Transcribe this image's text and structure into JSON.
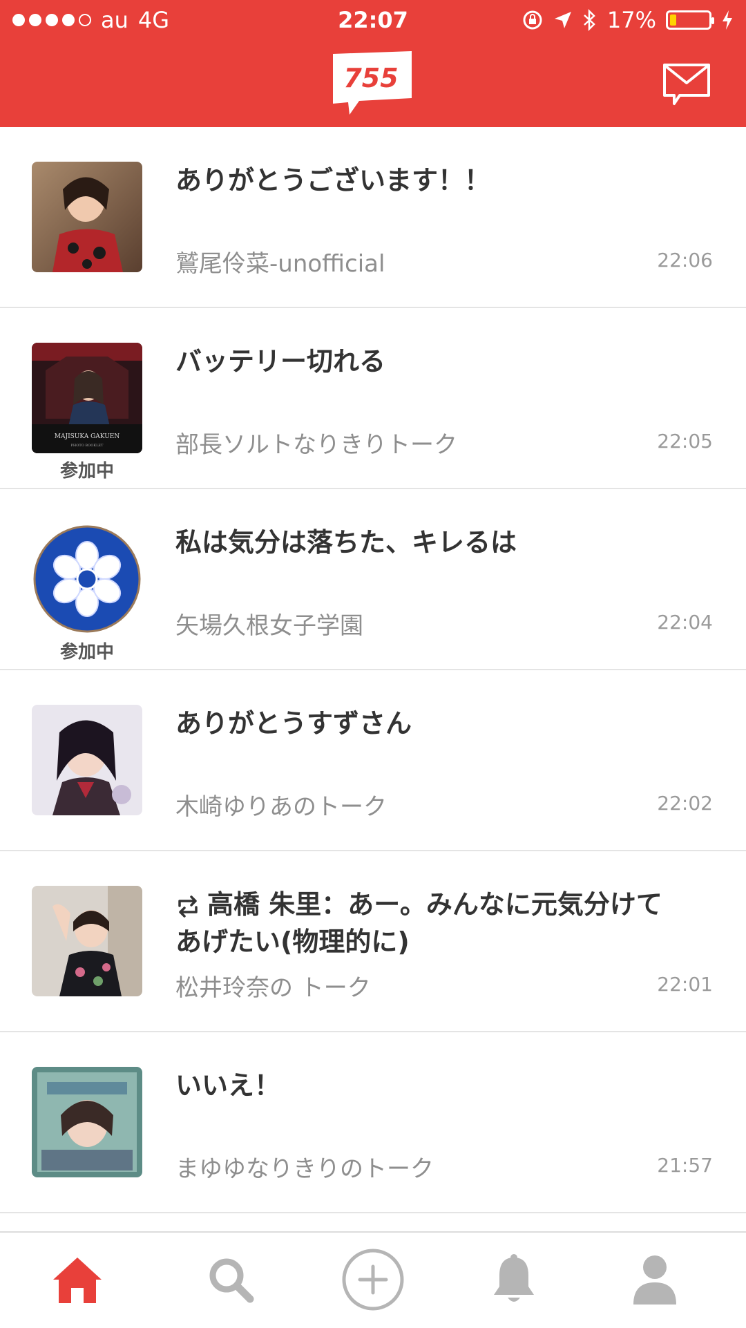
{
  "status_bar": {
    "carrier": "au",
    "network": "4G",
    "time": "22:07",
    "battery_percent_text": "17%",
    "battery_level": 0.17
  },
  "header": {
    "logo_text": "755",
    "mail_icon": "mail-icon"
  },
  "colors": {
    "brand": "#e8403a",
    "tab_active": "#e8403a",
    "tab_inactive": "#b5b5b5"
  },
  "talks": [
    {
      "title": "ありがとうございます！！",
      "talk_name": "鷲尾伶菜-unofficial",
      "time": "22:06",
      "joined": ""
    },
    {
      "title": "バッテリー切れる",
      "talk_name": "部長ソルトなりきりトーク",
      "time": "22:05",
      "joined": "参加中"
    },
    {
      "title": "私は気分は落ちた、キレるは",
      "talk_name": "矢場久根女子学園",
      "time": "22:04",
      "joined": "参加中"
    },
    {
      "title": "ありがとうすずさん",
      "talk_name": "木崎ゆりあのトーク",
      "time": "22:02",
      "joined": ""
    },
    {
      "title": "高橋 朱里：あー。みんなに元気分けてあげたい(物理的に)",
      "talk_name": "松井玲奈の トーク",
      "time": "22:01",
      "joined": "",
      "retalk": true
    },
    {
      "title": "いいえ！",
      "talk_name": "まゆゆなりきりのトーク",
      "time": "21:57",
      "joined": ""
    }
  ],
  "tabs": [
    {
      "name": "home",
      "icon": "home-icon",
      "active": true
    },
    {
      "name": "search",
      "icon": "search-icon",
      "active": false
    },
    {
      "name": "post",
      "icon": "add-circle-icon",
      "active": false
    },
    {
      "name": "notifications",
      "icon": "bell-icon",
      "active": false
    },
    {
      "name": "profile",
      "icon": "person-icon",
      "active": false
    }
  ]
}
